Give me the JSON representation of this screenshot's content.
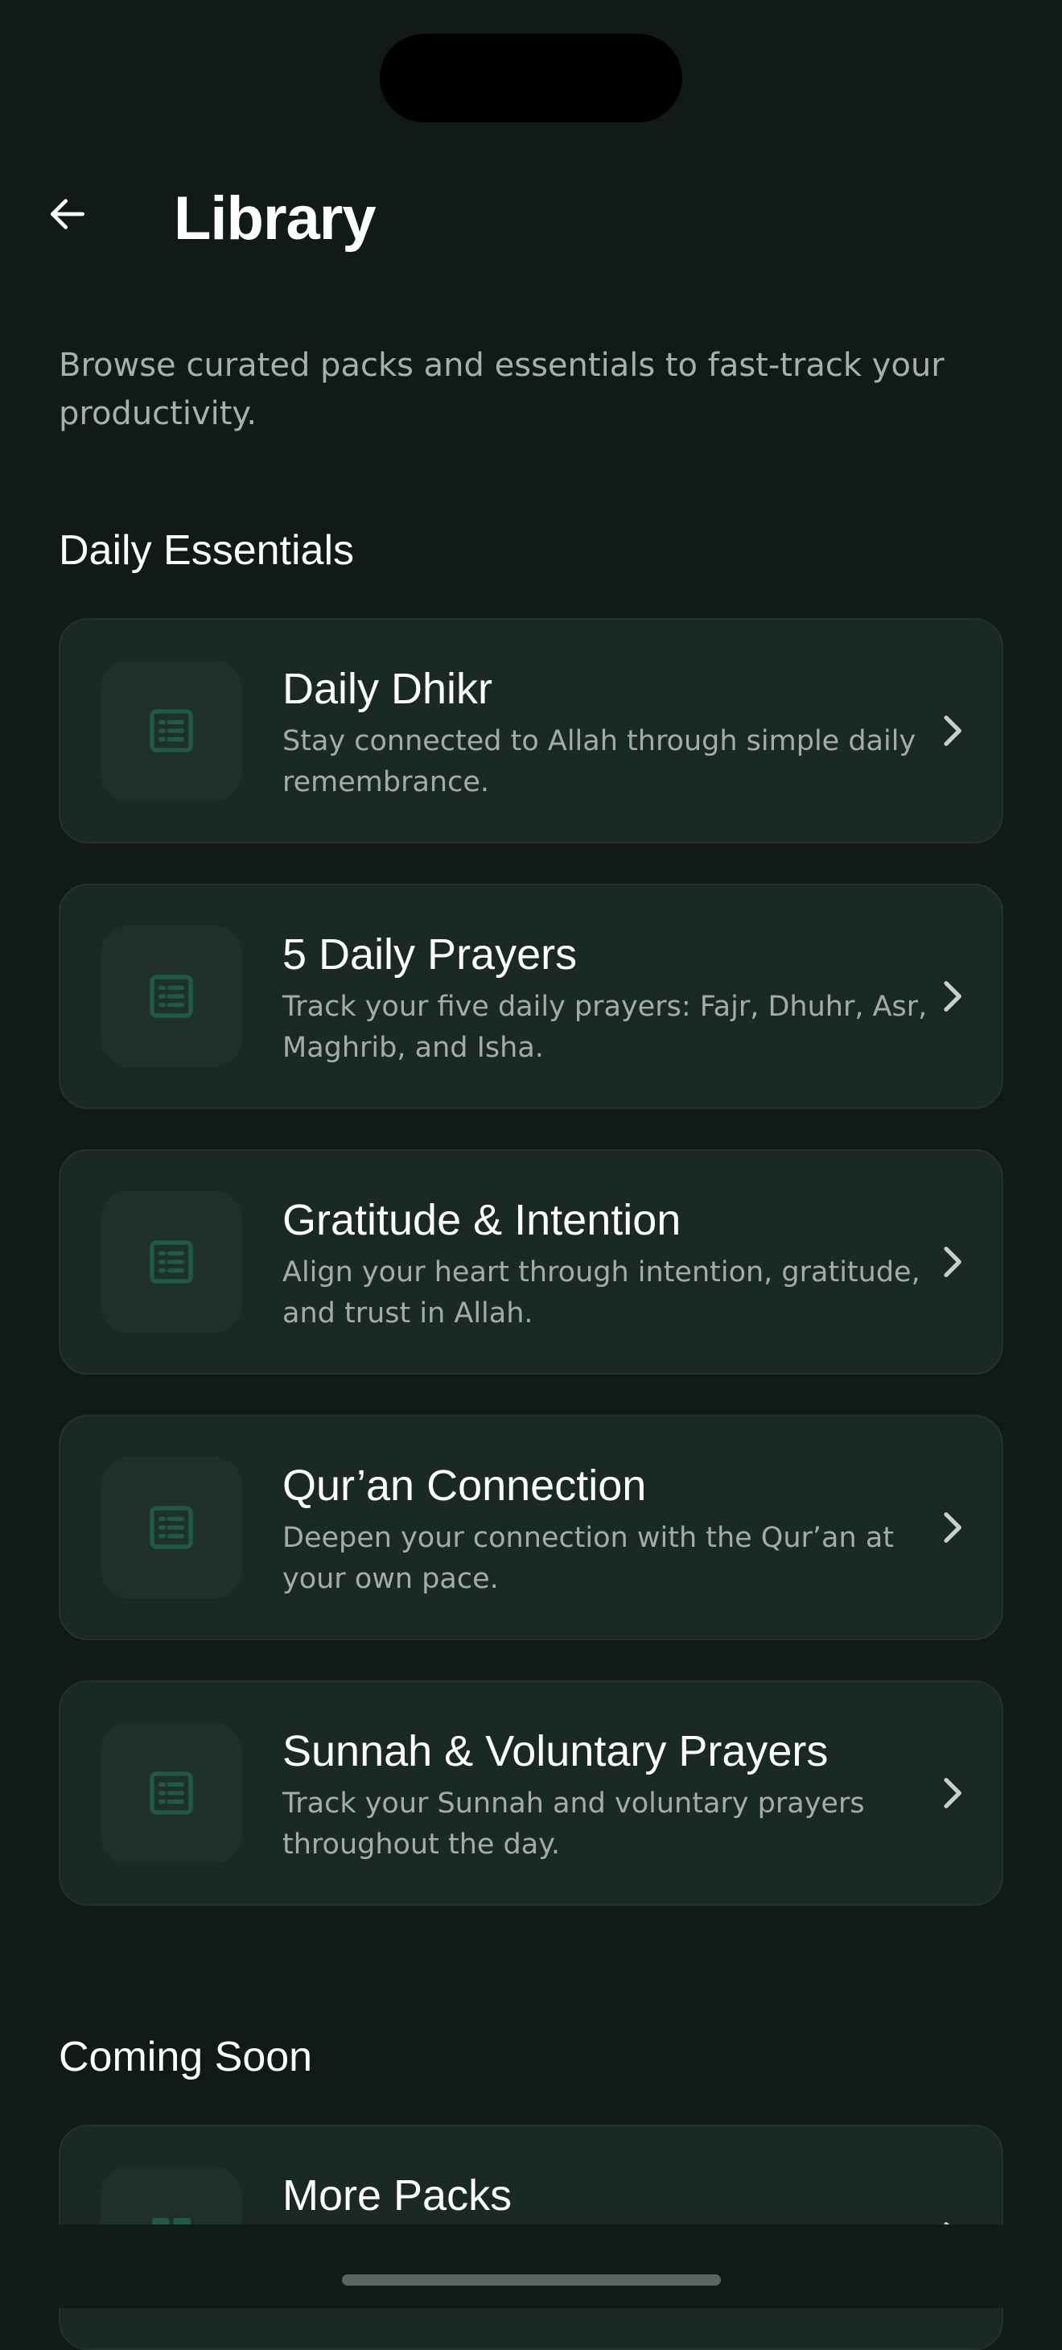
{
  "header": {
    "title": "Library",
    "back_icon": "arrow-left-icon"
  },
  "intro": "Browse curated packs and essentials to fast-track your productivity.",
  "sections": {
    "daily": {
      "title": "Daily Essentials",
      "items": [
        {
          "title": "Daily Dhikr",
          "description": "Stay connected to Allah through simple daily remembrance.",
          "icon": "list-icon"
        },
        {
          "title": "5 Daily Prayers",
          "description": "Track your five daily prayers: Fajr, Dhuhr, Asr, Maghrib, and Isha.",
          "icon": "list-icon"
        },
        {
          "title": "Gratitude & Intention",
          "description": "Align your heart through intention, gratitude, and trust in Allah.",
          "icon": "list-icon"
        },
        {
          "title": "Qur’an Connection",
          "description": "Deepen your connection with the Qur’an at your own pace.",
          "icon": "list-icon"
        },
        {
          "title": "Sunnah & Voluntary Prayers",
          "description": "Track your Sunnah and voluntary prayers throughout the day.",
          "icon": "list-icon"
        }
      ]
    },
    "coming_soon": {
      "title": "Coming Soon",
      "items": [
        {
          "title": "More Packs",
          "icon": "grid-icon"
        }
      ]
    }
  },
  "colors": {
    "background": "#111a18",
    "card": "#1b2926",
    "accent": "#1f5a47",
    "text_secondary": "#a3aca9"
  }
}
